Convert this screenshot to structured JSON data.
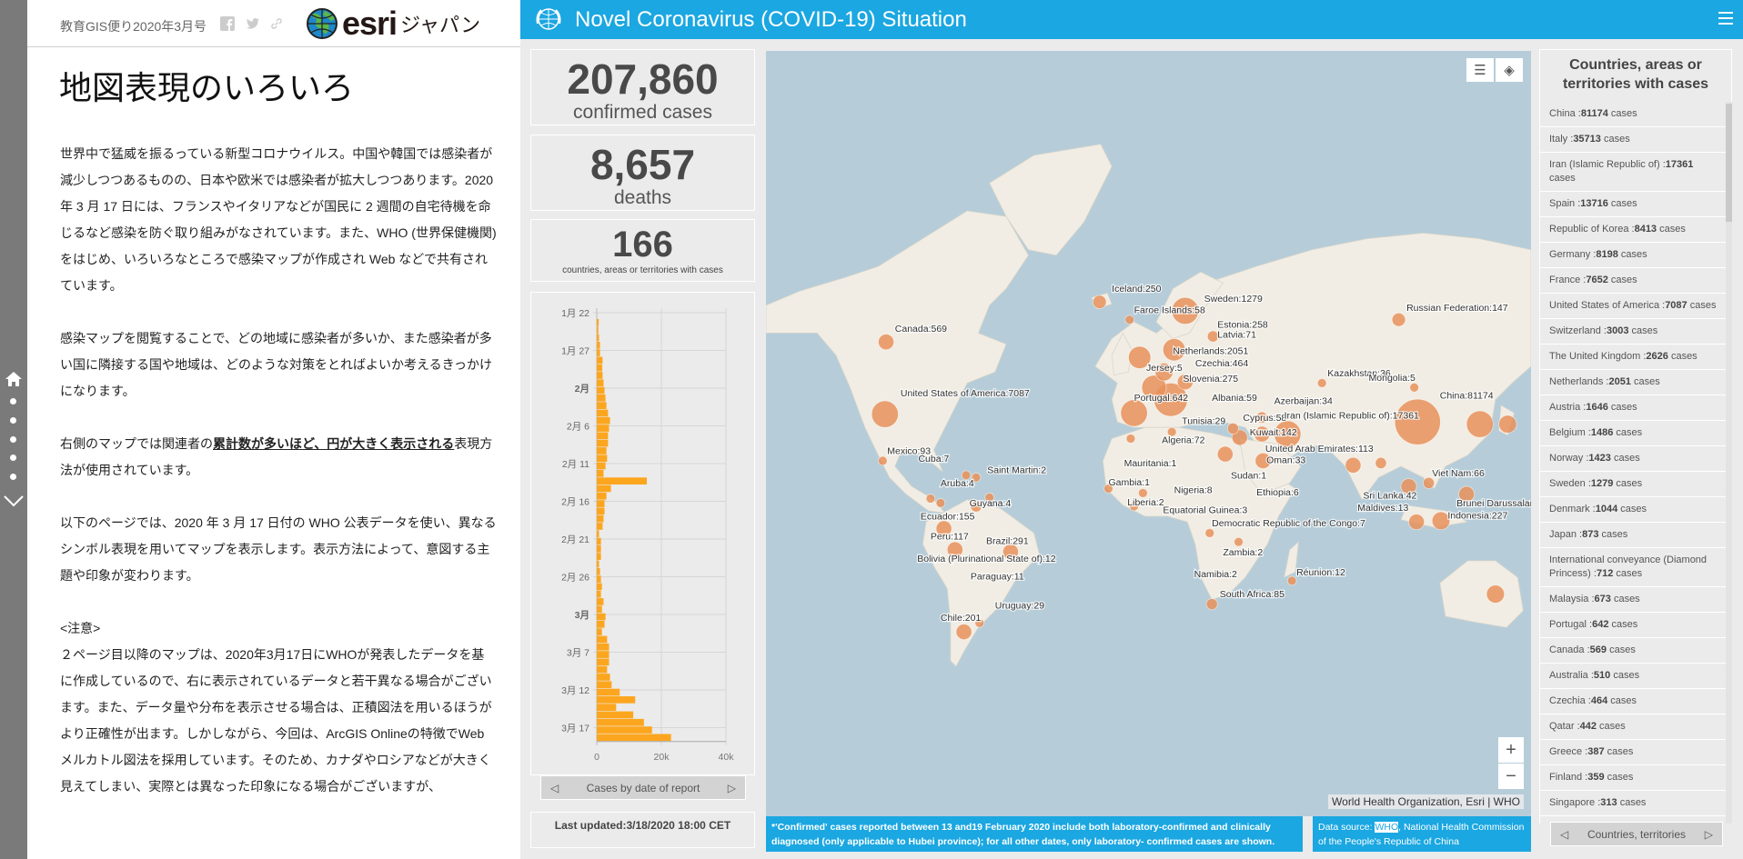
{
  "story": {
    "issue": "教育GIS便り2020年3月号",
    "logo_word": "esri",
    "logo_jp": "ジャパン",
    "title": "地図表現のいろいろ",
    "p1": "世界中で猛威を振るっている新型コロナウイルス。中国や韓国では感染者が減少しつつあるものの、日本や欧米では感染者が拡大しつつあります。2020 年 3 月 17 日には、フランスやイタリアなどが国民に 2 週間の自宅待機を命じるなど感染を防ぐ取り組みがなされています。また、WHO (世界保健機関) をはじめ、いろいろなところで感染マップが作成され Web などで共有されています。",
    "p2": "感染マップを閲覧することで、どの地域に感染者が多いか、また感染者が多い国に隣接する国や地域は、どのような対策をとればよいか考えるきっかけになります。",
    "p3_a": "右側のマップでは関連者の",
    "p3_u": "累計数が多いほど、円が大きく表示される",
    "p3_b": "表現方法が使用されています。",
    "p4": "以下のページでは、2020 年 3 月 17 日付の WHO 公表データを使い、異なるシンボル表現を用いてマップを表示します。表示方法によって、意図する主題や印象が変わります。",
    "p5_head": "<注意>",
    "p5": "２ページ目以降のマップは、2020年3月17日にWHOが発表したデータを基に作成しているので、右に表示されているデータと若干異なる場合がございます。また、データ量や分布を表示させる場合は、正積図法を用いるほうがより正確性が出ます。しかしながら、今回は、ArcGIS Onlineの特徴でWebメルカトル図法を採用しています。そのため、カナダやロシアなどが大きく見えてしまい、実際とは異なった印象になる場合がございますが、"
  },
  "dashboard": {
    "title": "Novel Coronavirus (COVID-19) Situation",
    "accent": "#1ba7e1",
    "confirmed": {
      "value": "207,860",
      "label": "confirmed cases"
    },
    "deaths": {
      "value": "8,657",
      "label": "deaths"
    },
    "countries": {
      "value": "166",
      "label": "countries, areas or territories with cases"
    },
    "chart_nav": "Cases by date of report",
    "last_updated": "Last updated:3/18/2020 18:00 CET",
    "attribution": "World Health Organization, Esri | WHO",
    "note_left": "*'Confirmed' cases reported between 13 and19 February 2020 include both laboratory-confirmed and clinically diagnosed (only  applicable to Hubei province); for all other dates, only laboratory-  confirmed cases are shown.",
    "note_right_a": "Data source: ",
    "note_right_hl": "WHO",
    "note_right_b": ", National Health Commission of the People's Republic of China",
    "list_title": "Countries, areas or territories with cases",
    "list_nav": "Countries, territories",
    "list": [
      {
        "name": "China",
        "cases": "81174"
      },
      {
        "name": "Italy",
        "cases": "35713"
      },
      {
        "name": "Iran (Islamic Republic of)",
        "cases": "17361"
      },
      {
        "name": "Spain",
        "cases": "13716"
      },
      {
        "name": "Republic of Korea",
        "cases": "8413"
      },
      {
        "name": "Germany",
        "cases": "8198"
      },
      {
        "name": "France",
        "cases": "7652"
      },
      {
        "name": "United States of America",
        "cases": "7087"
      },
      {
        "name": "Switzerland",
        "cases": "3003"
      },
      {
        "name": "The United Kingdom",
        "cases": "2626"
      },
      {
        "name": "Netherlands",
        "cases": "2051"
      },
      {
        "name": "Austria",
        "cases": "1646"
      },
      {
        "name": "Belgium",
        "cases": "1486"
      },
      {
        "name": "Norway",
        "cases": "1423"
      },
      {
        "name": "Sweden",
        "cases": "1279"
      },
      {
        "name": "Denmark",
        "cases": "1044"
      },
      {
        "name": "Japan",
        "cases": "873"
      },
      {
        "name": "International conveyance (Diamond Princess)",
        "cases": "712"
      },
      {
        "name": "Malaysia",
        "cases": "673"
      },
      {
        "name": "Portugal",
        "cases": "642"
      },
      {
        "name": "Canada",
        "cases": "569"
      },
      {
        "name": "Australia",
        "cases": "510"
      },
      {
        "name": "Czechia",
        "cases": "464"
      },
      {
        "name": "Qatar",
        "cases": "442"
      },
      {
        "name": "Greece",
        "cases": "387"
      },
      {
        "name": "Finland",
        "cases": "359"
      },
      {
        "name": "Singapore",
        "cases": "313"
      }
    ],
    "cases_suffix": "cases",
    "map_labels": [
      "Canada:569",
      "United States of America:7087",
      "Mexico:93",
      "Cuba:7",
      "Saint Martin:2",
      "Aruba:4",
      "Guyana:4",
      "Ecuador:155",
      "Peru:117",
      "Brazil:291",
      "Bolivia (Plurinational State of):12",
      "Paraguay:11",
      "Uruguay:29",
      "Chile:201",
      "Iceland:250",
      "Faroe Islands:58",
      "Sweden:1279",
      "Estonia:258",
      "Latvia:71",
      "Netherlands:2051",
      "Czechia:464",
      "Jersey:5",
      "Slovenia:275",
      "Portugal:642",
      "Albania:59",
      "Azerbaijan:34",
      "Tunisia:29",
      "Cyprus:58",
      "Iran (Islamic Republic of):17361",
      "Kuwait:142",
      "United Arab Emirates:113",
      "Oman:33",
      "Algeria:72",
      "Mauritania:1",
      "Gambia:1",
      "Sudan:1",
      "Nigeria:8",
      "Ethiopia:6",
      "Liberia:2",
      "Equatorial Guinea:3",
      "Democratic Republic of the Congo:7",
      "Zambia:2",
      "Namibia:2",
      "South Africa:85",
      "Réunion:12",
      "Kazakhstan:36",
      "Mongolia:5",
      "Russian Federation:147",
      "China:81174",
      "Viet Nam:66",
      "Sri Lanka:42",
      "Maldives:13",
      "Brunei Darussalam",
      "Indonesia:227"
    ],
    "map_colors": {
      "ocean": "#b6cdd9",
      "land": "#f1ede4",
      "symbol": "#e8905a"
    }
  },
  "chart_data": {
    "type": "bar",
    "orientation": "horizontal",
    "xlabel": "",
    "ylabel": "",
    "xlim": [
      0,
      40000
    ],
    "x_ticks": [
      "0",
      "20k",
      "40k"
    ],
    "y_ticks": [
      "1月 22",
      "1月 27",
      "2月",
      "2月 6",
      "2月 11",
      "2月 16",
      "2月 21",
      "2月 26",
      "3月",
      "3月 7",
      "3月 12",
      "3月 17"
    ],
    "values": [
      600,
      500,
      700,
      1000,
      1000,
      1800,
      1700,
      1800,
      2100,
      2400,
      2700,
      3000,
      3500,
      4100,
      3800,
      3500,
      3500,
      3000,
      3200,
      2700,
      2100,
      15500,
      4400,
      3000,
      2400,
      2400,
      2100,
      1800,
      700,
      1300,
      1300,
      1300,
      700,
      1000,
      1300,
      1600,
      1300,
      2100,
      1600,
      2700,
      2400,
      1600,
      3200,
      3800,
      3800,
      3800,
      3200,
      4100,
      4600,
      7100,
      11900,
      6000,
      11300,
      14600,
      17100,
      23000
    ],
    "bar_color": "#fca61f",
    "grid": true
  }
}
